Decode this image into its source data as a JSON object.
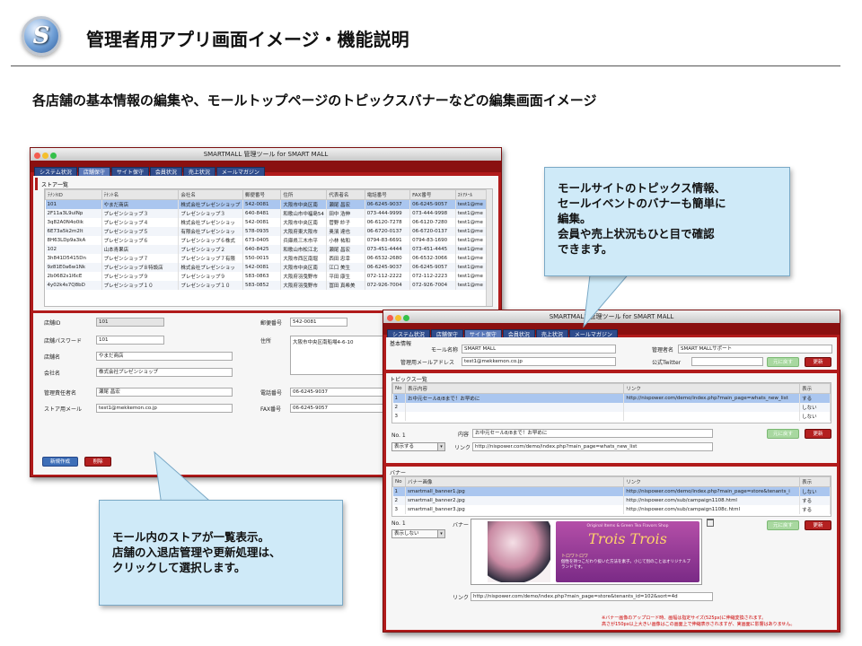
{
  "header": {
    "logo_letter": "S",
    "title": "管理者用アプリ画面イメージ・機能説明",
    "lead": "各店舗の基本情報の編集や、モールトップページのトピックスバナーなどの編集画面イメージ"
  },
  "win1": {
    "title": "SMARTMALL 管理ツール for SMART MALL",
    "tabs": [
      "システム状況",
      "店舗保守",
      "サイト保守",
      "会員状況",
      "売上状況",
      "メールマガジン"
    ],
    "list_title": "ストア一覧",
    "columns": [
      "ﾃﾅﾝﾄID",
      "ﾃﾅﾝﾄ名",
      "会社名",
      "郵便番号",
      "住所",
      "代表者名",
      "電話番号",
      "FAX番号",
      "ｽﾄｱﾒｰﾙ"
    ],
    "rows": [
      [
        "101",
        "やまだ商店",
        "株式会社プレゼンショップ",
        "542-0081",
        "大阪市中央区南",
        "瀬尾 昌宏",
        "06-6245-9037",
        "06-6245-9057",
        "test1@me"
      ],
      [
        "2F11a3L9uINp",
        "プレゼンショップ３",
        "プレゼンショップ３",
        "640-8481",
        "和歌山市中福島54",
        "田中 浩伸",
        "073-444-9999",
        "073-444-9998",
        "test1@me"
      ],
      [
        "3q82A0N4o0ik",
        "プレゼンショップ４",
        "株式会社プレゼンショッ",
        "542-0081",
        "大阪市中央区南",
        "菅野 紗子",
        "06-6120-7278",
        "06-6120-7280",
        "test1@me"
      ],
      [
        "6E73a5k2m2lt",
        "プレゼンショップ５",
        "有限会社プレゼンショッ",
        "578-0935",
        "大阪府東大阪市",
        "奥濱 達也",
        "06-6720-0137",
        "06-6720-0137",
        "test1@me"
      ],
      [
        "8H63LDp9a3kA",
        "プレゼンショップ６",
        "プレゼンショップ６株式",
        "673-0405",
        "兵庫県三木市平",
        "小林 祐和",
        "0794-83-6691",
        "0794-83-1690",
        "test1@me"
      ],
      [
        "102",
        "山本青果店",
        "プレゼンショップ２",
        "640-8425",
        "和歌山市松江北",
        "瀬尾 昌宏",
        "073-451-4444",
        "073-451-4445",
        "test1@me"
      ],
      [
        "3h841D5415Dn",
        "プレゼンショップ７",
        "プレゼンショップ７有限",
        "550-0015",
        "大阪市西区南堀",
        "西田 忠幸",
        "06-6532-2680",
        "06-6532-3066",
        "test1@me"
      ],
      [
        "9z81E0a6w1Nk",
        "プレゼンショップ８特設店",
        "株式会社プレゼンショッ",
        "542-0081",
        "大阪市中央区南",
        "江口 美生",
        "06-6245-9037",
        "06-6245-9057",
        "test1@me"
      ],
      [
        "2b0682s1l6cE",
        "プレゼンショップ９",
        "プレゼンショップ９",
        "583-0863",
        "大阪府羽曳野市",
        "平田 康生",
        "072-112-2222",
        "072-112-2223",
        "test1@me"
      ],
      [
        "4y02k4s7Q8bD",
        "プレゼンショップ１０",
        "プレゼンショップ１０",
        "583-0852",
        "大阪府羽曳野市",
        "冨田 真希美",
        "072-926-7004",
        "072-926-7004",
        "test1@me"
      ]
    ],
    "form": {
      "store_id_label": "店舗ID",
      "store_id": "101",
      "password_label": "店舗パスワード",
      "password": "101",
      "store_name_label": "店舗名",
      "store_name": "やまだ商店",
      "company_label": "会社名",
      "company": "株式会社プレゼンショップ",
      "manager_label": "管理責任者名",
      "manager": "瀬尾 昌宏",
      "mail_label": "ストア用メール",
      "mail": "test1@mekkemon.co.jp",
      "zip_label": "郵便番号",
      "zip": "542-0081",
      "address_label": "住所",
      "address": "大阪市中央区南船場4-6-10",
      "tel_label": "電話番号",
      "tel": "06-6245-9037",
      "fax_label": "FAX番号",
      "fax": "06-6245-9057"
    },
    "new_btn": "新規作成",
    "delete_btn": "削除"
  },
  "win2": {
    "title": "SMARTMALL 管理ツール for SMART MALL",
    "tabs": [
      "システム状況",
      "店舗保守",
      "サイト保守",
      "会員状況",
      "売上状況",
      "メールマガジン"
    ],
    "basic_title": "基本情報",
    "mall_name_label": "モール名称",
    "mall_name": "SMART MALL",
    "admin_mail_label": "管理用メールアドレス",
    "admin_mail": "test1@mekkemon.co.jp",
    "admin_name_label": "管理者名",
    "admin_name": "SMART MALLサポート",
    "twitter_label": "公式Twitter",
    "twitter": "",
    "revert_btn": "元に戻す",
    "update_btn": "更新",
    "topics_title": "トピックス一覧",
    "topics_cols": [
      "No",
      "表示内容",
      "リンク",
      "表示"
    ],
    "topics_rows": [
      [
        "1",
        "お中元セール8/8まで！お早めに",
        "http://nispower.com/demo/index.php?main_page=whats_new_list",
        "する"
      ],
      [
        "2",
        "",
        "",
        "しない"
      ],
      [
        "3",
        "",
        "",
        "しない"
      ]
    ],
    "topic_no": "No. 1",
    "topic_content_label": "内容",
    "topic_content": "お中元セール8/8まで！お早めに",
    "topic_show": "表示する",
    "topic_link_label": "リンク",
    "topic_link": "http://nispower.com/demo/index.php?main_page=whats_new_list",
    "banner_title": "バナー",
    "banner_cols": [
      "No",
      "バナー画像",
      "リンク",
      "表示"
    ],
    "banner_rows": [
      [
        "1",
        "smartmall_banner1.jpg",
        "http://nispower.com/demo/index.php?main_page=store&tenants_i",
        "しない"
      ],
      [
        "2",
        "smartmall_banner2.jpg",
        "http://nispower.com/sub/campaign1108.html",
        "する"
      ],
      [
        "3",
        "smartmall_banner3.jpg",
        "http://nispower.com/sub/campaign1108c.html",
        "する"
      ]
    ],
    "banner_no": "No. 1",
    "banner_label": "バナー",
    "banner_show": "表示しない",
    "banner_link_label": "リンク",
    "banner_link": "http://nispower.com/demo/index.php?main_page=store&tenants_id=102&sort=4d",
    "banner_text_top": "Original Items & Green Tea Flavors Shop",
    "banner_text_brand": "Trois Trois",
    "banner_text_sub": "トロワトロワ",
    "banner_text_desc": "個性を持つこだわり抜いた方法を素子。小じて別のことはオリジナルブランドです。",
    "note1": "※バナー画像のアップロード時、画幅は指定サイズ(525px)に伸縮変換されます。",
    "note2": "高さが150px以上大きい画像はこの画面上で伸縮表示されますが、実画面に影響はありません。"
  },
  "callouts": {
    "right": [
      "モールサイトのトピックス情報、",
      "セールイベントのバナーも簡単に",
      "編集。",
      "会員や売上状況もひと目で確認",
      "できます。"
    ],
    "left": [
      "モール内のストアが一覧表示。",
      "店舗の入退店管理や更新処理は、",
      "クリックして選択します。"
    ]
  },
  "colors": {
    "window_red": "#b11b1b",
    "tab_blue": "#2f4c8c",
    "selected_row": "#aac6ef",
    "callout_bg": "#cfeaf8"
  }
}
